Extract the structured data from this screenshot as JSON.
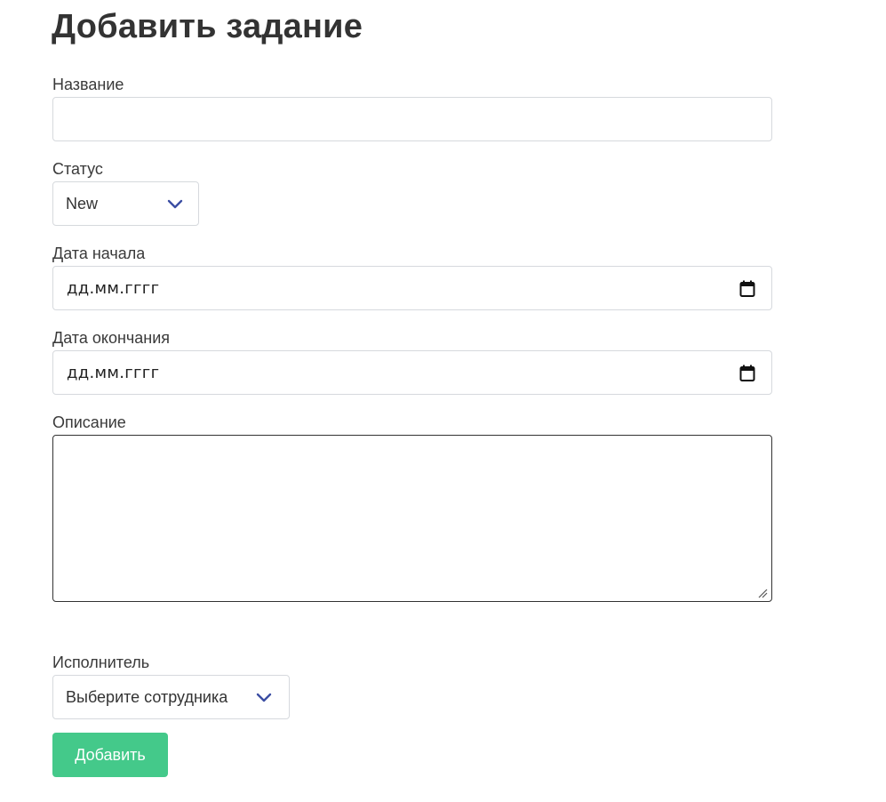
{
  "page": {
    "title": "Добавить задание"
  },
  "form": {
    "name_label": "Название",
    "name_value": "",
    "status_label": "Статус",
    "status_value": "New",
    "start_date_label": "Дата начала",
    "start_date_placeholder": "дд.мм.гггг",
    "end_date_label": "Дата окончания",
    "end_date_placeholder": "дд.мм.гггг",
    "description_label": "Описание",
    "description_value": "",
    "assignee_label": "Исполнитель",
    "assignee_value": "Выберите сотрудника",
    "submit_label": "Добавить"
  },
  "icons": {
    "select_arrow": "chevron-down-icon",
    "date_picker": "calendar-icon",
    "resize": "resize-grip-icon"
  },
  "colors": {
    "primary_button": "#44c98a",
    "chevron": "#3b4ea3",
    "border": "#d6d9dd",
    "focused_border": "#333333"
  }
}
